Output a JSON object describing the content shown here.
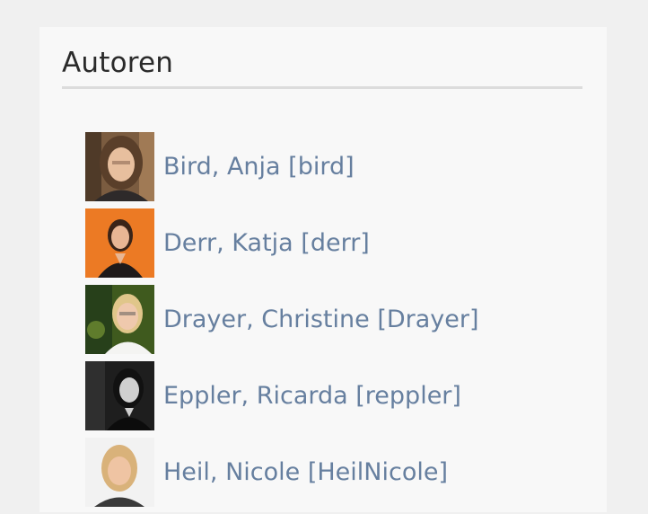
{
  "panel": {
    "title": "Autoren"
  },
  "authors": [
    {
      "label": "Bird, Anja [bird]"
    },
    {
      "label": "Derr, Katja [derr]"
    },
    {
      "label": "Drayer, Christine [Drayer]"
    },
    {
      "label": "Eppler, Ricarda [reppler]"
    },
    {
      "label": "Heil, Nicole [HeilNicole]"
    }
  ],
  "colors": {
    "page_background": "#f0f0f0",
    "panel_background": "#f8f8f8",
    "title_text": "#2a2a2a",
    "divider": "#dcdcdc",
    "link_text": "#667f9f"
  }
}
